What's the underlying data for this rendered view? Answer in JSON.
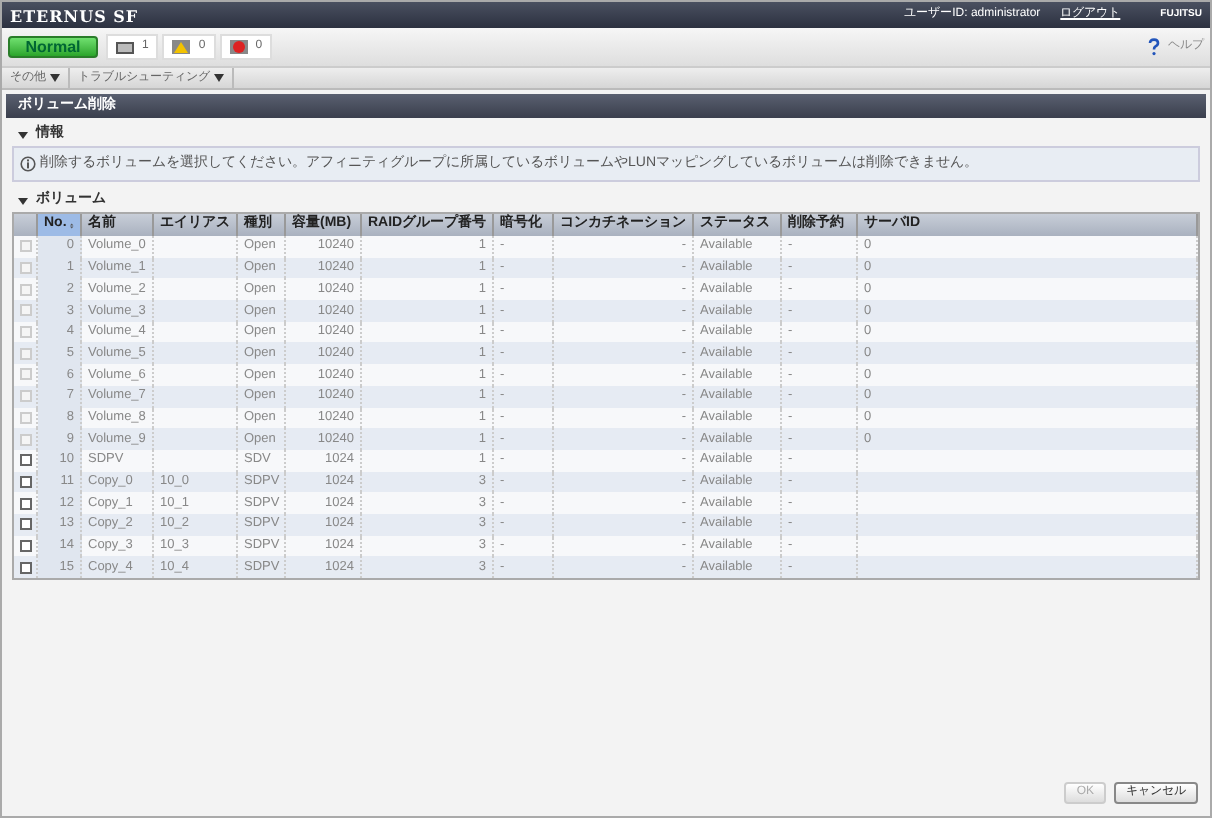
{
  "header": {
    "logo": "ETERNUS SF",
    "user": "ユーザーID: administrator",
    "logout": "ログアウト",
    "brand": "FUJITSU"
  },
  "status": {
    "label": "Normal",
    "counts": [
      {
        "kind": "device",
        "count": "1"
      },
      {
        "kind": "warning",
        "count": "0"
      },
      {
        "kind": "error",
        "count": "0"
      }
    ]
  },
  "help": "ヘルプ",
  "menus": [
    "その他",
    "トラブルシューティング"
  ],
  "page_title": "ボリューム削除",
  "info": {
    "heading": "情報",
    "expanded": true,
    "message": "削除するボリュームを選択してください。アフィニティグループに所属しているボリュームやLUNマッピングしているボリュームは削除できません。"
  },
  "volumes": {
    "heading": "ボリューム",
    "expanded": true,
    "columns": [
      {
        "label": "No.",
        "sorted": true
      },
      {
        "label": "名前",
        "sorted": false
      },
      {
        "label": "エイリアス",
        "sorted": false
      },
      {
        "label": "種別",
        "sorted": false
      },
      {
        "label": "容量(MB)",
        "sorted": false
      },
      {
        "label": "RAIDグループ番号",
        "sorted": false
      },
      {
        "label": "暗号化",
        "sorted": false
      },
      {
        "label": "コンカチネーション",
        "sorted": false
      },
      {
        "label": "ステータス",
        "sorted": false
      },
      {
        "label": "削除予約",
        "sorted": false
      },
      {
        "label": "サーバID",
        "sorted": false
      }
    ],
    "rows": [
      {
        "disabled": true,
        "checked": false,
        "cells": [
          "0",
          "Volume_0",
          "",
          "Open",
          "10240",
          "1",
          "-",
          "-",
          "Available",
          "-",
          "0"
        ]
      },
      {
        "disabled": true,
        "checked": false,
        "cells": [
          "1",
          "Volume_1",
          "",
          "Open",
          "10240",
          "1",
          "-",
          "-",
          "Available",
          "-",
          "0"
        ]
      },
      {
        "disabled": true,
        "checked": false,
        "cells": [
          "2",
          "Volume_2",
          "",
          "Open",
          "10240",
          "1",
          "-",
          "-",
          "Available",
          "-",
          "0"
        ]
      },
      {
        "disabled": true,
        "checked": false,
        "cells": [
          "3",
          "Volume_3",
          "",
          "Open",
          "10240",
          "1",
          "-",
          "-",
          "Available",
          "-",
          "0"
        ]
      },
      {
        "disabled": true,
        "checked": false,
        "cells": [
          "4",
          "Volume_4",
          "",
          "Open",
          "10240",
          "1",
          "-",
          "-",
          "Available",
          "-",
          "0"
        ]
      },
      {
        "disabled": true,
        "checked": false,
        "cells": [
          "5",
          "Volume_5",
          "",
          "Open",
          "10240",
          "1",
          "-",
          "-",
          "Available",
          "-",
          "0"
        ]
      },
      {
        "disabled": true,
        "checked": false,
        "cells": [
          "6",
          "Volume_6",
          "",
          "Open",
          "10240",
          "1",
          "-",
          "-",
          "Available",
          "-",
          "0"
        ]
      },
      {
        "disabled": true,
        "checked": false,
        "cells": [
          "7",
          "Volume_7",
          "",
          "Open",
          "10240",
          "1",
          "-",
          "-",
          "Available",
          "-",
          "0"
        ]
      },
      {
        "disabled": true,
        "checked": false,
        "cells": [
          "8",
          "Volume_8",
          "",
          "Open",
          "10240",
          "1",
          "-",
          "-",
          "Available",
          "-",
          "0"
        ]
      },
      {
        "disabled": true,
        "checked": false,
        "cells": [
          "9",
          "Volume_9",
          "",
          "Open",
          "10240",
          "1",
          "-",
          "-",
          "Available",
          "-",
          "0"
        ]
      },
      {
        "disabled": false,
        "checked": false,
        "cells": [
          "10",
          "SDPV",
          "",
          "SDV",
          "1024",
          "1",
          "-",
          "-",
          "Available",
          "-",
          ""
        ]
      },
      {
        "disabled": false,
        "checked": false,
        "cells": [
          "11",
          "Copy_0",
          "10_0",
          "SDPV",
          "1024",
          "3",
          "-",
          "-",
          "Available",
          "-",
          ""
        ]
      },
      {
        "disabled": false,
        "checked": false,
        "cells": [
          "12",
          "Copy_1",
          "10_1",
          "SDPV",
          "1024",
          "3",
          "-",
          "-",
          "Available",
          "-",
          ""
        ]
      },
      {
        "disabled": false,
        "checked": false,
        "cells": [
          "13",
          "Copy_2",
          "10_2",
          "SDPV",
          "1024",
          "3",
          "-",
          "-",
          "Available",
          "-",
          ""
        ]
      },
      {
        "disabled": false,
        "checked": false,
        "cells": [
          "14",
          "Copy_3",
          "10_3",
          "SDPV",
          "1024",
          "3",
          "-",
          "-",
          "Available",
          "-",
          ""
        ]
      },
      {
        "disabled": false,
        "checked": false,
        "cells": [
          "15",
          "Copy_4",
          "10_4",
          "SDPV",
          "1024",
          "3",
          "-",
          "-",
          "Available",
          "-",
          ""
        ]
      }
    ]
  },
  "buttons": [
    {
      "label": "OK",
      "disabled": true
    },
    {
      "label": "キャンセル",
      "disabled": false
    }
  ]
}
